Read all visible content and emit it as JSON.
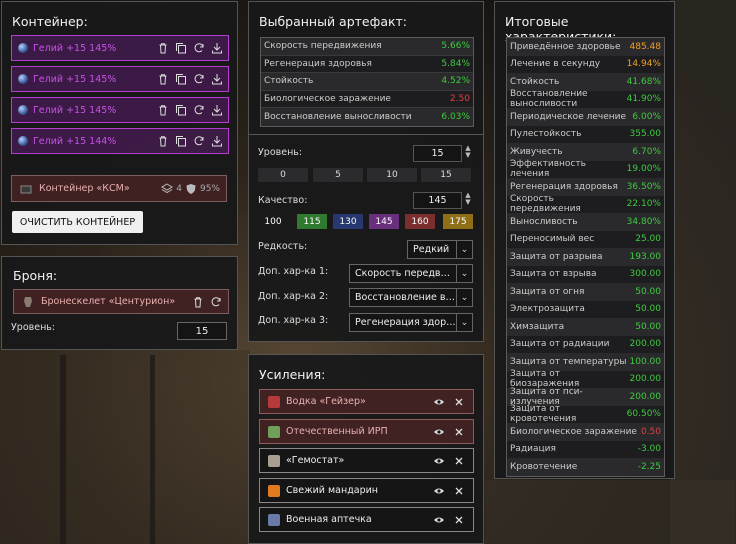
{
  "container": {
    "title": "Контейнер:",
    "slots": [
      {
        "label": "Гелий +15 145%"
      },
      {
        "label": "Гелий +15 145%"
      },
      {
        "label": "Гелий +15 145%"
      },
      {
        "label": "Гелий +15 144%"
      }
    ],
    "ksm": {
      "label": "Контейнер «КСМ»",
      "slots_count": "4",
      "protection": "95%"
    },
    "clear_button": "ОЧИСТИТЬ КОНТЕЙНЕР"
  },
  "armor": {
    "title": "Броня:",
    "item": "Бронескелет «Центурион»",
    "level_label": "Уровень:",
    "level_value": "15"
  },
  "artifact": {
    "title": "Выбранный артефакт:",
    "stats": [
      {
        "name": "Скорость передвижения",
        "value": "5.66%",
        "color": "#3ecb3e"
      },
      {
        "name": "Регенерация здоровья",
        "value": "5.84%",
        "color": "#3ecb3e"
      },
      {
        "name": "Стойкость",
        "value": "4.52%",
        "color": "#3ecb3e"
      },
      {
        "name": "Биологическое заражение",
        "value": "2.50",
        "color": "#e04040"
      },
      {
        "name": "Восстановление выносливости",
        "value": "6.03%",
        "color": "#3ecb3e"
      }
    ],
    "level_label": "Уровень:",
    "level_value": "15",
    "level_presets": [
      "0",
      "5",
      "10",
      "15"
    ],
    "quality_label": "Качество:",
    "quality_value": "145",
    "quality_presets": [
      {
        "label": "100",
        "color": "#1a1a1a"
      },
      {
        "label": "115",
        "color": "#2f7a2f"
      },
      {
        "label": "130",
        "color": "#27376f"
      },
      {
        "label": "145",
        "color": "#6a2f7c"
      },
      {
        "label": "160",
        "color": "#7a2e2e"
      },
      {
        "label": "175",
        "color": "#8e6e16"
      }
    ],
    "rarity_label": "Редкость:",
    "rarity_value": "Редкий",
    "extra1_label": "Доп. хар-ка 1:",
    "extra1_value": "Скорость передвижения",
    "extra2_label": "Доп. хар-ка 2:",
    "extra2_value": "Восстановление выносливости",
    "extra3_label": "Доп. хар-ка 3:",
    "extra3_value": "Регенерация здоровья"
  },
  "boosts": {
    "title": "Усиления:",
    "items": [
      {
        "label": "Водка «Гейзер»",
        "style": "red",
        "icon_color": "#b53a3a"
      },
      {
        "label": "Отечественный ИРП",
        "style": "red",
        "icon_color": "#6fa05a"
      },
      {
        "label": "«Гемостат»",
        "style": "dark",
        "icon_color": "#a8a090"
      },
      {
        "label": "Свежий мандарин",
        "style": "dark",
        "icon_color": "#e07a20"
      },
      {
        "label": "Военная аптечка",
        "style": "dark",
        "icon_color": "#6a7aa8"
      }
    ]
  },
  "totals": {
    "title": "Итоговые характеристики:",
    "rows": [
      {
        "name": "Приведённое здоровье",
        "value": "485.48",
        "color": "#f0a020"
      },
      {
        "name": "Лечение в секунду",
        "value": "14.94%",
        "color": "#f0a020"
      },
      {
        "name": "Стойкость",
        "value": "41.68%",
        "color": "#3ecb3e"
      },
      {
        "name": "Восстановление выносливости",
        "value": "41.90%",
        "color": "#3ecb3e"
      },
      {
        "name": "Периодическое лечение",
        "value": "6.00%",
        "color": "#3ecb3e"
      },
      {
        "name": "Пулестойкость",
        "value": "355.00",
        "color": "#3ecb3e"
      },
      {
        "name": "Живучесть",
        "value": "6.70%",
        "color": "#3ecb3e"
      },
      {
        "name": "Эффективность лечения",
        "value": "19.00%",
        "color": "#3ecb3e"
      },
      {
        "name": "Регенерация здоровья",
        "value": "36.50%",
        "color": "#3ecb3e"
      },
      {
        "name": "Скорость передвижения",
        "value": "22.10%",
        "color": "#3ecb3e"
      },
      {
        "name": "Выносливость",
        "value": "34.80%",
        "color": "#3ecb3e"
      },
      {
        "name": "Переносимый вес",
        "value": "25.00",
        "color": "#3ecb3e"
      },
      {
        "name": "Защита от разрыва",
        "value": "193.00",
        "color": "#3ecb3e"
      },
      {
        "name": "Защита от взрыва",
        "value": "300.00",
        "color": "#3ecb3e"
      },
      {
        "name": "Защита от огня",
        "value": "50.00",
        "color": "#3ecb3e"
      },
      {
        "name": "Электрозащита",
        "value": "50.00",
        "color": "#3ecb3e"
      },
      {
        "name": "Химзащита",
        "value": "50.00",
        "color": "#3ecb3e"
      },
      {
        "name": "Защита от радиации",
        "value": "200.00",
        "color": "#3ecb3e"
      },
      {
        "name": "Защита от температуры",
        "value": "100.00",
        "color": "#3ecb3e"
      },
      {
        "name": "Защита от биозаражения",
        "value": "200.00",
        "color": "#3ecb3e"
      },
      {
        "name": "Защита от пси-излучения",
        "value": "200.00",
        "color": "#3ecb3e"
      },
      {
        "name": "Защита от кровотечения",
        "value": "60.50%",
        "color": "#3ecb3e"
      },
      {
        "name": "Биологическое заражение",
        "value": "0.50",
        "color": "#e04040"
      },
      {
        "name": "Радиация",
        "value": "-3.00",
        "color": "#3ecb3e"
      },
      {
        "name": "Кровотечение",
        "value": "-2.25",
        "color": "#3ecb3e"
      }
    ]
  }
}
